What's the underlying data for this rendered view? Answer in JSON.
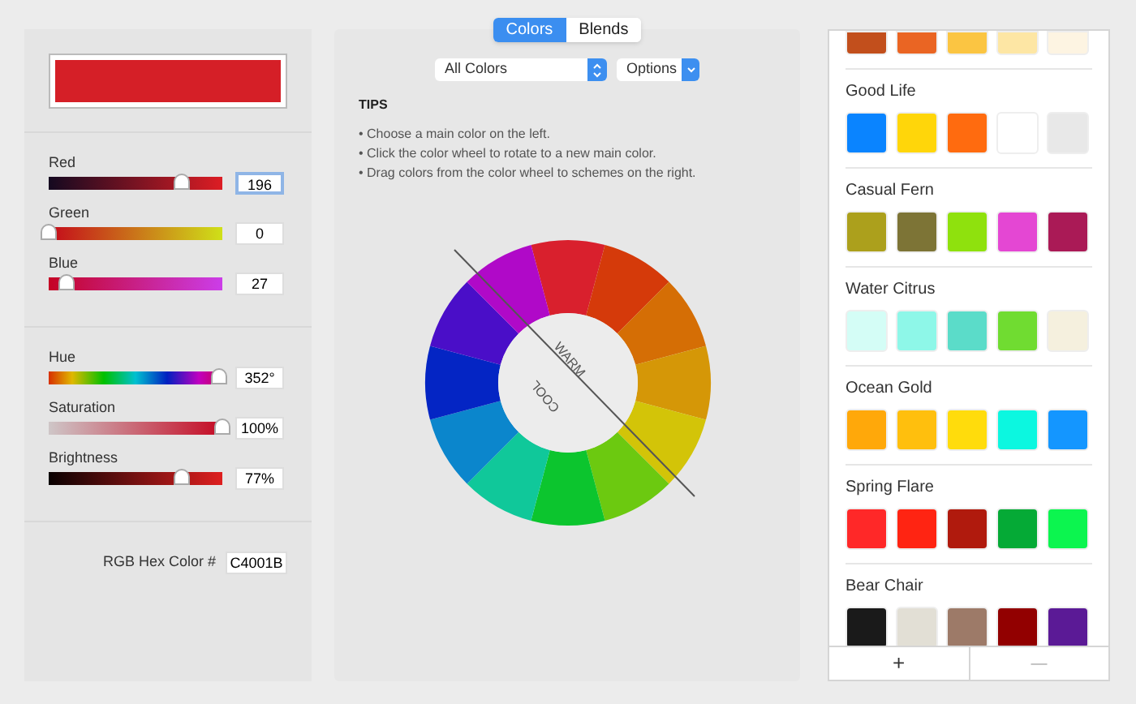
{
  "main_color": {
    "color": "#d51f27"
  },
  "rgb_sliders": [
    {
      "label": "Red",
      "kind": "red",
      "level": 0.77,
      "value": "196",
      "focused": true
    },
    {
      "label": "Green",
      "kind": "green",
      "level": 0.0,
      "value": "0",
      "focused": false
    },
    {
      "label": "Blue",
      "kind": "blue",
      "level": 0.1,
      "value": "27",
      "focused": false
    }
  ],
  "hsb_sliders": [
    {
      "label": "Hue",
      "kind": "hue",
      "level": 0.98,
      "value": "352°",
      "focused": false
    },
    {
      "label": "Saturation",
      "kind": "saturation",
      "level": 1.0,
      "value": "100%",
      "focused": false
    },
    {
      "label": "Brightness",
      "kind": "brightness",
      "level": 0.77,
      "value": "77%",
      "focused": false
    }
  ],
  "hex": {
    "label": "RGB Hex Color #",
    "value": "C4001B"
  },
  "tabs": [
    {
      "label": "Colors",
      "selected": true
    },
    {
      "label": "Blends",
      "selected": false
    }
  ],
  "dropdowns": {
    "scope": "All Colors",
    "options": "Options"
  },
  "tips": {
    "title": "TIPS",
    "lines": [
      "• Choose a main color on the left.",
      "• Click the color wheel to rotate to a new main color.",
      "• Drag colors from the color wheel to schemes on the right."
    ]
  },
  "wheel": {
    "warm": "WARM",
    "cool": "COOL"
  },
  "schemes": [
    {
      "swatches": [
        {
          "color": "#c24f1c"
        },
        {
          "color": "#ea6523"
        },
        {
          "color": "#fbc542"
        },
        {
          "color": "#fde6a4"
        },
        {
          "color": "#fdf4e2"
        }
      ]
    },
    {
      "name": "Good Life",
      "swatches": [
        {
          "color": "#0a84ff"
        },
        {
          "color": "#ffd60a"
        },
        {
          "color": "#ff6b0f"
        },
        {
          "color": "#ffffff"
        },
        {
          "color": "#e8e8e8"
        }
      ]
    },
    {
      "name": "Casual Fern",
      "swatches": [
        {
          "color": "#aca01c"
        },
        {
          "color": "#7d7436"
        },
        {
          "color": "#8fe10d"
        },
        {
          "color": "#e447d3"
        },
        {
          "color": "#aa1a56"
        }
      ]
    },
    {
      "name": "Water Citrus",
      "swatches": [
        {
          "color": "#d4fdf6"
        },
        {
          "color": "#8ef7e8"
        },
        {
          "color": "#5bdcc9"
        },
        {
          "color": "#70dc31"
        },
        {
          "color": "#f5f0de"
        }
      ]
    },
    {
      "name": "Ocean Gold",
      "swatches": [
        {
          "color": "#ffa80a"
        },
        {
          "color": "#ffbf0d"
        },
        {
          "color": "#ffdc0c"
        },
        {
          "color": "#0cf7e0"
        },
        {
          "color": "#1496ff"
        }
      ]
    },
    {
      "name": "Spring Flare",
      "swatches": [
        {
          "color": "#ff2828"
        },
        {
          "color": "#ff2412"
        },
        {
          "color": "#b01a0d"
        },
        {
          "color": "#05aa36"
        },
        {
          "color": "#0cf54f"
        }
      ]
    },
    {
      "name": "Bear Chair",
      "swatches": [
        {
          "color": "#1a1a1a"
        },
        {
          "color": "#e2dfd5"
        },
        {
          "color": "#9d7a68"
        },
        {
          "color": "#920000"
        },
        {
          "color": "#5b1a96"
        }
      ]
    }
  ],
  "scheme_buttons": {
    "add": "+",
    "remove": "—"
  }
}
